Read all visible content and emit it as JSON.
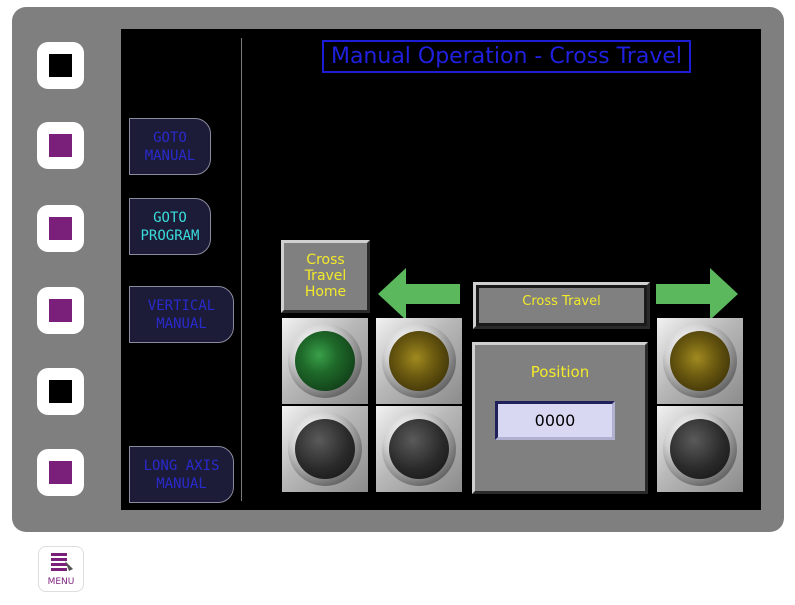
{
  "title": "Manual Operation - Cross Travel",
  "side_buttons": [
    {
      "state": "black"
    },
    {
      "state": "purple"
    },
    {
      "state": "purple"
    },
    {
      "state": "purple"
    },
    {
      "state": "black"
    },
    {
      "state": "purple"
    }
  ],
  "nav": {
    "goto_manual": "GOTO\nMANUAL",
    "goto_program": "GOTO\nPROGRAM",
    "vertical_manual": "VERTICAL\nMANUAL",
    "long_axis_manual": "LONG AXIS\nMANUAL"
  },
  "cross_travel_home": "Cross\nTravel\nHome",
  "cross_travel": "Cross Travel",
  "position": {
    "label": "Position",
    "value": "0000"
  },
  "menu_label": "MENU",
  "colors": {
    "title": "#2020e0",
    "nav_active": "#3adcdc",
    "nav_inactive": "#2a2acc",
    "label_yellow": "#f2ea2a",
    "arrow": "#5cb85c",
    "lamp_green": "#1f7a2a",
    "lamp_amber": "#6b5a10",
    "button_purple": "#7a1f7a"
  }
}
